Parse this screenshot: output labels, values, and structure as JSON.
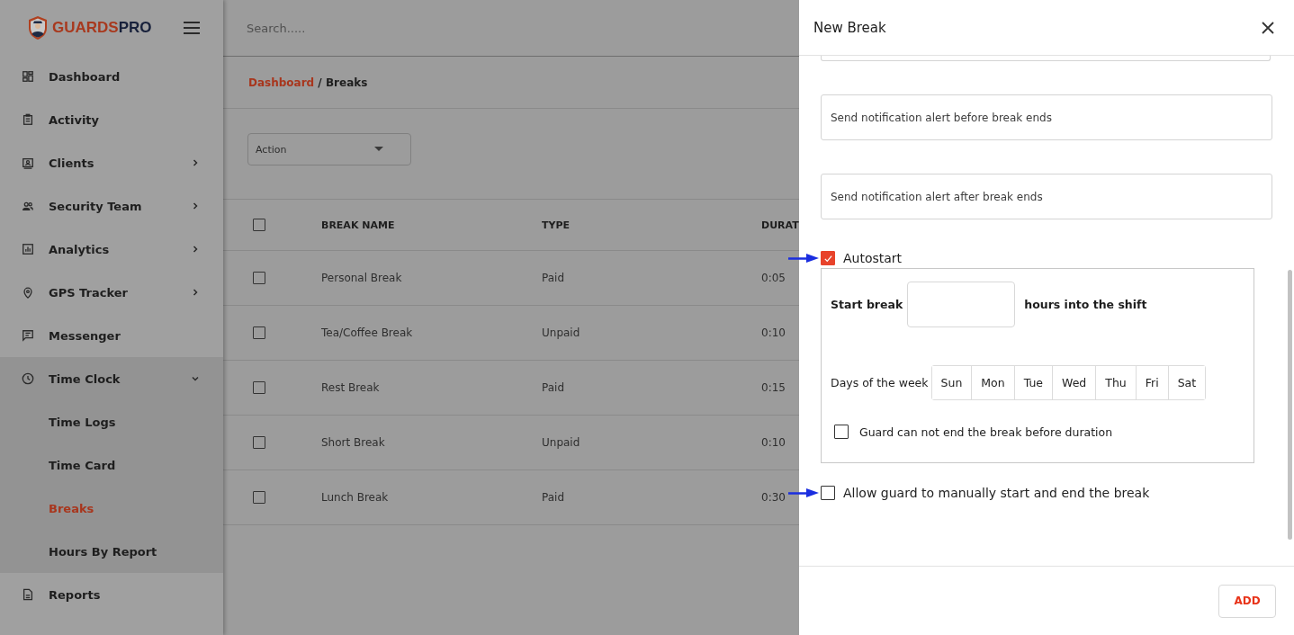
{
  "sidebar": {
    "brand": {
      "main": "GUARDS",
      "accent": "PRO"
    },
    "items": [
      {
        "label": "Dashboard",
        "has_submenu": false,
        "expanded": false,
        "selected": false
      },
      {
        "label": "Activity",
        "has_submenu": false,
        "expanded": false,
        "selected": false
      },
      {
        "label": "Clients",
        "has_submenu": true,
        "expanded": false,
        "selected": false
      },
      {
        "label": "Security Team",
        "has_submenu": true,
        "expanded": false,
        "selected": false
      },
      {
        "label": "Analytics",
        "has_submenu": true,
        "expanded": false,
        "selected": false
      },
      {
        "label": "GPS Tracker",
        "has_submenu": true,
        "expanded": false,
        "selected": false
      },
      {
        "label": "Messenger",
        "has_submenu": false,
        "expanded": false,
        "selected": false
      },
      {
        "label": "Time Clock",
        "has_submenu": true,
        "expanded": true,
        "selected": false,
        "children": [
          {
            "label": "Time Logs",
            "selected": false
          },
          {
            "label": "Time Card",
            "selected": false
          },
          {
            "label": "Breaks",
            "selected": true
          },
          {
            "label": "Hours By Report",
            "selected": false
          }
        ]
      },
      {
        "label": "Reports",
        "has_submenu": false,
        "expanded": false,
        "selected": false
      }
    ]
  },
  "search": {
    "placeholder": "Search....."
  },
  "breadcrumb": {
    "link": "Dashboard",
    "separator": "/",
    "current": "Breaks"
  },
  "action_dropdown": {
    "label": "Action"
  },
  "table": {
    "columns": [
      "BREAK NAME",
      "TYPE",
      "DURAT"
    ],
    "all_checked": false,
    "rows": [
      {
        "checked": false,
        "cells": [
          "Personal Break",
          "Paid",
          "0:05"
        ]
      },
      {
        "checked": false,
        "cells": [
          "Tea/Coffee Break",
          "Unpaid",
          "0:10"
        ]
      },
      {
        "checked": false,
        "cells": [
          "Rest Break",
          "Paid",
          "0:15"
        ]
      },
      {
        "checked": false,
        "cells": [
          "Short Break",
          "Unpaid",
          "0:10"
        ]
      },
      {
        "checked": false,
        "cells": [
          "Lunch Break",
          "Paid",
          "0:30"
        ]
      }
    ]
  },
  "drawer": {
    "title": "New Break",
    "fields": [
      {
        "placeholder": "Send notification alert before break ends"
      },
      {
        "placeholder": "Send notification alert after break ends"
      }
    ],
    "autostart": {
      "label": "Autostart",
      "checked": true
    },
    "start_break": {
      "label": "Start break",
      "suffix": "hours into the shift"
    },
    "days": {
      "label": "Days of the week",
      "items": [
        {
          "label": "Sun",
          "selected": false
        },
        {
          "label": "Mon",
          "selected": false
        },
        {
          "label": "Tue",
          "selected": false
        },
        {
          "label": "Wed",
          "selected": false
        },
        {
          "label": "Thu",
          "selected": false
        },
        {
          "label": "Fri",
          "selected": false
        },
        {
          "label": "Sat",
          "selected": false
        }
      ]
    },
    "no_early_end": {
      "label": "Guard can not end the break before duration",
      "checked": false
    },
    "manual": {
      "label": "Allow guard to manually start and end the break",
      "checked": false
    },
    "add_button": "ADD"
  }
}
